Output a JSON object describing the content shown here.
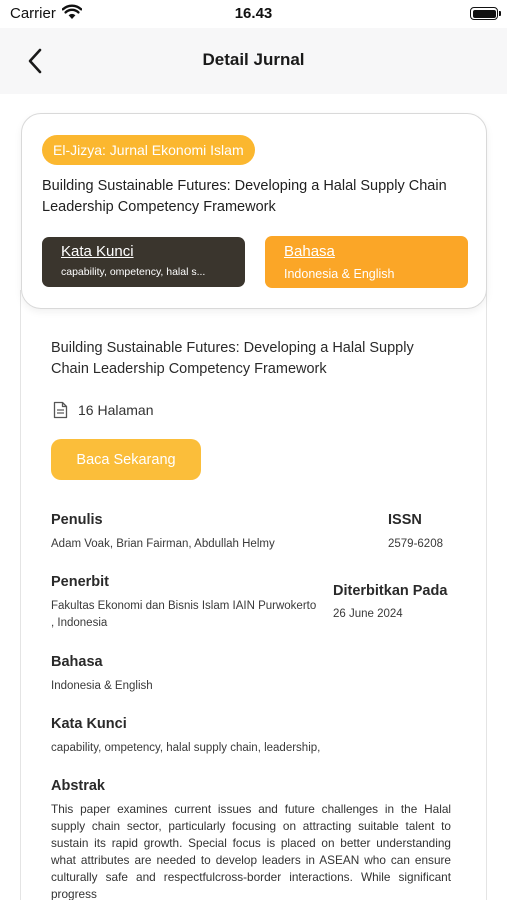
{
  "status_bar": {
    "carrier": "Carrier",
    "time": "16.43"
  },
  "nav": {
    "title": "Detail Jurnal"
  },
  "summary_card": {
    "journal_name": "El-Jizya: Jurnal Ekonomi Islam",
    "title": "Building Sustainable Futures: Developing a Halal Supply Chain Leadership Competency Framework",
    "keywords_label": "Kata Kunci",
    "keywords_preview": "capability, ompetency, halal s...",
    "language_label": "Bahasa",
    "language_value": "Indonesia & English"
  },
  "detail": {
    "title": "Building Sustainable Futures: Developing a Halal Supply Chain Leadership Competency Framework",
    "pages": "16 Halaman",
    "read_button": "Baca Sekarang",
    "author_label": "Penulis",
    "authors": "Adam Voak, Brian Fairman, Abdullah Helmy",
    "issn_label": "ISSN",
    "issn": "2579-6208",
    "publisher_label": "Penerbit",
    "publisher": "Fakultas Ekonomi dan Bisnis Islam IAIN Purwokerto , Indonesia",
    "published_label": "Diterbitkan Pada",
    "published_date": "26 June 2024",
    "language_label": "Bahasa",
    "language": "Indonesia & English",
    "keywords_label": "Kata Kunci",
    "keywords": "capability, ompetency, halal supply chain, leadership,",
    "abstract_label": "Abstrak",
    "abstract": "This paper examines current issues and future challenges in the Halal supply chain sector, particularly focusing on attracting suitable talent to sustain its rapid growth. Special focus is placed on better understanding what attributes are needed to develop leaders in ASEAN who can ensure culturally safe and respectfulcross-border interactions. While significant progress"
  },
  "icons": {
    "wifi": "wifi-icon",
    "battery": "battery-icon",
    "back": "chevron-left-icon",
    "document": "document-icon"
  },
  "colors": {
    "accent_yellow": "#fbb72f",
    "accent_orange": "#fba627",
    "dark_brown": "#3a352d",
    "button_yellow": "#fbbe3a"
  }
}
